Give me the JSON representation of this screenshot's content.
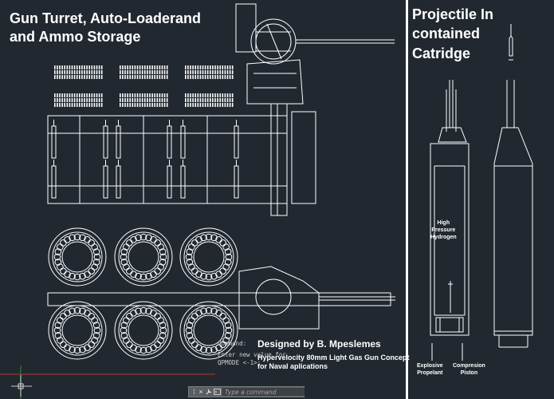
{
  "left_panel": {
    "title": "Gun Turret, Auto-Loaderand\nand Ammo Storage",
    "designer": "Designed by B. Mpeslemes",
    "subtitle_line1": "Hypervelocity 80mm Light Gas Gun Concept",
    "subtitle_line2": "for Naval aplications"
  },
  "right_panel": {
    "title": "Projectile In\ncontained\nCatridge",
    "labels": {
      "high_pressure": "High\nPressure\nHydrogen",
      "explosive": "Explosive\nPropelant",
      "piston": "Compresion\nPiston"
    }
  },
  "command_line": {
    "history": [
      "Command:",
      "Enter new value for",
      "QPMODE <-1>:"
    ],
    "placeholder": "Type a command",
    "close_icon": "×",
    "settings_icon": "wrench",
    "prompt_icon": "terminal"
  },
  "colors": {
    "background": "#212830",
    "linework": "#ffffff",
    "separator": "#ffffff",
    "axis_red": "#c0392b",
    "axis_green": "#2e8b3a"
  }
}
